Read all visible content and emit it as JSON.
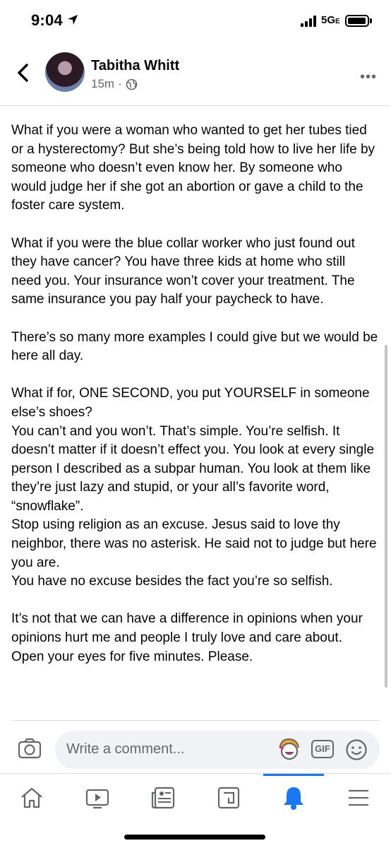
{
  "status_bar": {
    "time": "9:04",
    "network": "5G",
    "network_suffix": "E"
  },
  "header": {
    "author": "Tabitha Whitt",
    "time_ago": "15m",
    "dot": "·"
  },
  "post": {
    "paragraphs": [
      "What if you were a woman who wanted to get her tubes tied or a hysterectomy? But she’s being told how to live her life by someone who doesn’t even know her. By someone who would judge her if she got an abortion or gave a child to the foster care system.",
      "What if you were the blue collar worker who just found out they have cancer? You have three kids at home who still need you. Your insurance won’t cover your treatment. The same insurance you pay half your paycheck to have.",
      "There’s so many more examples I could give but we would be here all day.",
      "What if for, ONE SECOND, you put YOURSELF in someone else’s shoes?\nYou can’t and you won’t. That’s simple. You’re selfish. It doesn’t matter if it doesn’t effect you. You look at every single person I described as a subpar human. You look at them like they’re just lazy and stupid, or your all’s favorite word, “snowflake”.\nStop using religion as an excuse. Jesus said to love thy neighbor, there was no asterisk. He said not to judge but here you are.\nYou have no excuse besides the fact you’re so selfish.",
      "It’s not that we can have a difference in opinions when your opinions hurt me and people I truly love and care about.\nOpen your eyes for five minutes. Please."
    ]
  },
  "comment_bar": {
    "placeholder": "Write a comment...",
    "gif_label": "GIF"
  },
  "nav": {
    "tabs": [
      {
        "name": "home",
        "icon": "home-icon",
        "active": false
      },
      {
        "name": "watch",
        "icon": "video-icon",
        "active": false
      },
      {
        "name": "news",
        "icon": "news-feed-icon",
        "active": false
      },
      {
        "name": "groups",
        "icon": "groups-icon",
        "active": false
      },
      {
        "name": "notifications",
        "icon": "bell-icon",
        "active": true
      },
      {
        "name": "menu",
        "icon": "hamburger-icon",
        "active": false
      }
    ]
  },
  "colors": {
    "accent": "#1877f2",
    "secondary_text": "#65676b",
    "input_bg": "#f0f2f5"
  }
}
